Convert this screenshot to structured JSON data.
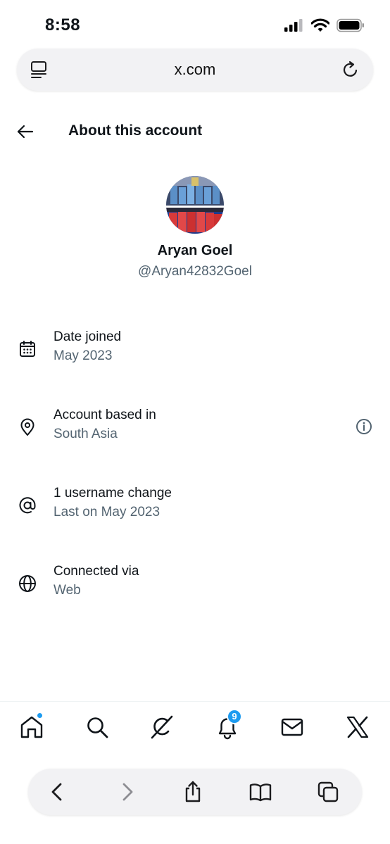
{
  "status_bar": {
    "time": "8:58"
  },
  "browser": {
    "url": "x.com",
    "reader_icon": "reader-icon",
    "reload_icon": "reload-icon"
  },
  "header": {
    "title": "About this account",
    "back_icon": "back-arrow-icon"
  },
  "profile": {
    "name": "Aryan Goel",
    "handle": "@Aryan42832Goel"
  },
  "info_rows": [
    {
      "label": "Date joined",
      "value": "May 2023",
      "icon": "calendar-icon"
    },
    {
      "label": "Account based in",
      "value": "South Asia",
      "icon": "location-pin-icon",
      "has_info_button": true
    },
    {
      "label": "1 username change",
      "value": "Last on May 2023",
      "icon": "at-sign-icon"
    },
    {
      "label": "Connected via",
      "value": "Web",
      "icon": "globe-icon"
    }
  ],
  "bottom_nav": {
    "items": [
      "home-icon",
      "search-icon",
      "grok-icon",
      "notifications-icon",
      "messages-icon",
      "x-logo-icon"
    ],
    "notifications_count": "9"
  },
  "safari_toolbar": {
    "items": [
      "back-icon",
      "forward-icon",
      "share-icon",
      "bookmarks-icon",
      "tabs-icon"
    ]
  },
  "colors": {
    "text_primary": "#0f1419",
    "text_secondary": "#536471",
    "accent": "#1d9bf0"
  }
}
